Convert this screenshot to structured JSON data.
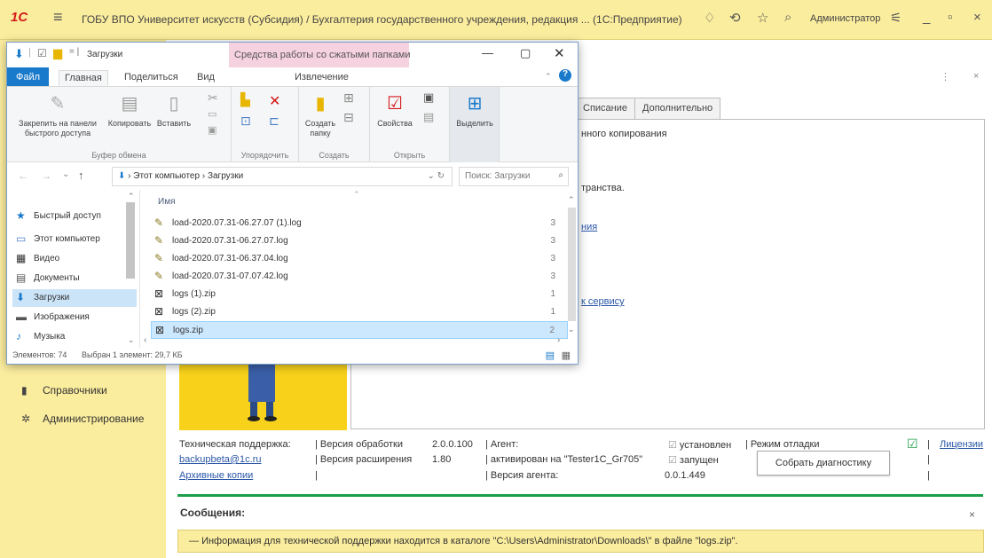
{
  "app": {
    "logo": "1С",
    "title": "ГОБУ ВПО Университет искусств (Субсидия) / Бухгалтерия государственного учреждения, редакция ... (1С:Предприятие)",
    "user": "Администратор"
  },
  "left_nav": [
    {
      "label": "Справочники",
      "icon": "book-icon"
    },
    {
      "label": "Администрирование",
      "icon": "gear-icon"
    }
  ],
  "form": {
    "tabs": [
      "Списание",
      "Дополнительно"
    ],
    "texts": [
      "нного копирования",
      "транства.",
      "ния",
      "к сервису"
    ],
    "support_label": "Техническая поддержка:",
    "support_email": "backupbeta@1c.ru",
    "archive_link": "Архивные копии",
    "proc_version_label": "Версия обработки",
    "proc_version": "2.0.0.100",
    "ext_version_label": "Версия расширения",
    "ext_version": "1.80",
    "agent_label": "Агент:",
    "agent_activated": "активирован на \"Tester1C_Gr705\"",
    "agent_version_label": "Версия агента:",
    "agent_version": "0.0.1.449",
    "installed_label": "установлен",
    "running_label": "запущен",
    "debug_label": "Режим отладки",
    "licenses_link": "Лицензии",
    "diag_button": "Собрать диагностику"
  },
  "messages": {
    "header": "Сообщения:",
    "text": "Информация для технической поддержки находится в каталоге \"C:\\Users\\Administrator\\Downloads\\\" в файле \"logs.zip\"."
  },
  "explorer": {
    "title": "Загрузки",
    "context_tab": "Средства работы со сжатыми папками",
    "context_sub": "Извлечение",
    "menu_tabs": [
      "Файл",
      "Главная",
      "Поделиться",
      "Вид"
    ],
    "ribbon": {
      "pin": "Закрепить на панели быстрого доступа",
      "copy": "Копировать",
      "paste": "Вставить",
      "clipboard_group": "Буфер обмена",
      "organize_group": "Упорядочить",
      "new_folder": "Создать папку",
      "create_group": "Создать",
      "properties": "Свойства",
      "open_group": "Открыть",
      "select": "Выделить"
    },
    "address": [
      "Этот компьютер",
      "Загрузки"
    ],
    "search_placeholder": "Поиск: Загрузки",
    "column_name": "Имя",
    "nav": [
      {
        "label": "Быстрый доступ",
        "icon": "star-icon"
      },
      {
        "label": "Этот компьютер",
        "icon": "computer-icon"
      },
      {
        "label": "Видео",
        "icon": "video-icon"
      },
      {
        "label": "Документы",
        "icon": "document-icon"
      },
      {
        "label": "Загрузки",
        "icon": "download-icon"
      },
      {
        "label": "Изображения",
        "icon": "image-icon"
      },
      {
        "label": "Музыка",
        "icon": "music-icon"
      }
    ],
    "files": [
      {
        "name": "load-2020.07.31-06.27.07 (1).log",
        "size": "3",
        "icon": "log-file-icon"
      },
      {
        "name": "load-2020.07.31-06.27.07.log",
        "size": "3",
        "icon": "log-file-icon"
      },
      {
        "name": "load-2020.07.31-06.37.04.log",
        "size": "3",
        "icon": "log-file-icon"
      },
      {
        "name": "load-2020.07.31-07.07.42.log",
        "size": "3",
        "icon": "log-file-icon"
      },
      {
        "name": "logs (1).zip",
        "size": "1",
        "icon": "zip-file-icon"
      },
      {
        "name": "logs (2).zip",
        "size": "1",
        "icon": "zip-file-icon"
      },
      {
        "name": "logs.zip",
        "size": "2",
        "icon": "zip-file-icon",
        "selected": true
      }
    ],
    "status_count": "Элементов: 74",
    "status_selected": "Выбран 1 элемент: 29,7 КБ"
  },
  "colors": {
    "accent_bar": "#fbed9e",
    "separator": "#1e9d4a",
    "explorer_blue": "#1979ca"
  }
}
